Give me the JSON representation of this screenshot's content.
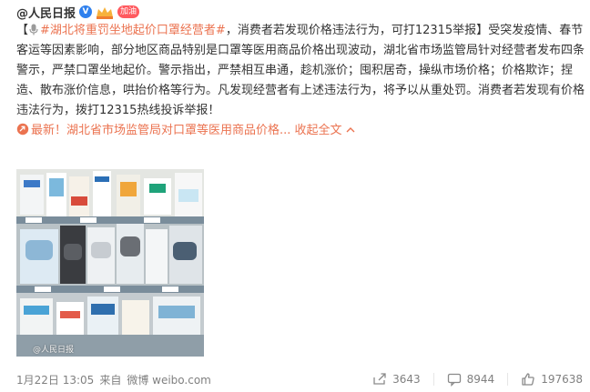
{
  "post": {
    "author": "@人民日报",
    "verified_badge": "V",
    "cheer_badge": "加油",
    "open_bracket": "【",
    "topic": "#湖北将重罚坐地起价口罩经营者#",
    "headline_rest": "，消费者若发现价格违法行为，可打12315举报",
    "close_bracket": "】",
    "body": "受突发疫情、春节客运等因素影响，部分地区商品特别是口罩等医用商品价格出现波动，湖北省市场监管局针对经营者发布四条警示，严禁口罩坐地起价。警示指出，严禁相互串通，趁机涨价；囤积居奇，操纵市场价格；价格欺诈；捏造、散布涨价信息，哄抬价格等行为。凡发现经营者有上述违法行为，将予以从重处罚。消费者若发现有价格违法行为，拨打12315热线投诉举报！",
    "latest_link": "最新！湖北省市场监管局对口罩等医用商品价格...",
    "collapse_label": "收起全文",
    "collapse_chevron": "⌵"
  },
  "image": {
    "watermark": "@人民日报"
  },
  "footer": {
    "date": "1月22日 13:05",
    "from_label": "来自",
    "source": "微博 weibo.com",
    "repost_count": "3643",
    "comment_count": "8944",
    "like_count": "197638"
  },
  "colors": {
    "link": "#eb7350",
    "text": "#333333",
    "meta": "#808080"
  }
}
